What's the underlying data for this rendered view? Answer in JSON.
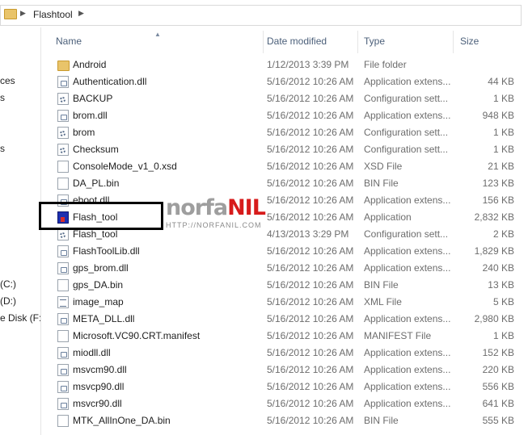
{
  "address": {
    "path": "Flashtool"
  },
  "nav": {
    "items": [
      "ces",
      "s",
      "s",
      "(C:)",
      "(D:)",
      "e Disk (F:)"
    ]
  },
  "columns": {
    "name": "Name",
    "date": "Date modified",
    "type": "Type",
    "size": "Size"
  },
  "files": [
    {
      "name": "Android",
      "date": "1/12/2013 3:39 PM",
      "type": "File folder",
      "size": "",
      "icon": "folder-icon"
    },
    {
      "name": "Authentication.dll",
      "date": "5/16/2012 10:26 AM",
      "type": "Application extens...",
      "size": "44 KB",
      "icon": "dll-icon"
    },
    {
      "name": "BACKUP",
      "date": "5/16/2012 10:26 AM",
      "type": "Configuration sett...",
      "size": "1 KB",
      "icon": "config-icon"
    },
    {
      "name": "brom.dll",
      "date": "5/16/2012 10:26 AM",
      "type": "Application extens...",
      "size": "948 KB",
      "icon": "dll-icon"
    },
    {
      "name": "brom",
      "date": "5/16/2012 10:26 AM",
      "type": "Configuration sett...",
      "size": "1 KB",
      "icon": "config-icon"
    },
    {
      "name": "Checksum",
      "date": "5/16/2012 10:26 AM",
      "type": "Configuration sett...",
      "size": "1 KB",
      "icon": "config-icon"
    },
    {
      "name": "ConsoleMode_v1_0.xsd",
      "date": "5/16/2012 10:26 AM",
      "type": "XSD File",
      "size": "21 KB",
      "icon": "document-icon"
    },
    {
      "name": "DA_PL.bin",
      "date": "5/16/2012 10:26 AM",
      "type": "BIN File",
      "size": "123 KB",
      "icon": "document-icon"
    },
    {
      "name": "eboot.dll",
      "date": "5/16/2012 10:26 AM",
      "type": "Application extens...",
      "size": "156 KB",
      "icon": "dll-icon"
    },
    {
      "name": "Flash_tool",
      "date": "5/16/2012 10:26 AM",
      "type": "Application",
      "size": "2,832 KB",
      "icon": "application-icon"
    },
    {
      "name": "Flash_tool",
      "date": "4/13/2013 3:29 PM",
      "type": "Configuration sett...",
      "size": "2 KB",
      "icon": "config-icon"
    },
    {
      "name": "FlashToolLib.dll",
      "date": "5/16/2012 10:26 AM",
      "type": "Application extens...",
      "size": "1,829 KB",
      "icon": "dll-icon"
    },
    {
      "name": "gps_brom.dll",
      "date": "5/16/2012 10:26 AM",
      "type": "Application extens...",
      "size": "240 KB",
      "icon": "dll-icon"
    },
    {
      "name": "gps_DA.bin",
      "date": "5/16/2012 10:26 AM",
      "type": "BIN File",
      "size": "13 KB",
      "icon": "document-icon"
    },
    {
      "name": "image_map",
      "date": "5/16/2012 10:26 AM",
      "type": "XML File",
      "size": "5 KB",
      "icon": "xml-icon"
    },
    {
      "name": "META_DLL.dll",
      "date": "5/16/2012 10:26 AM",
      "type": "Application extens...",
      "size": "2,980 KB",
      "icon": "dll-icon"
    },
    {
      "name": "Microsoft.VC90.CRT.manifest",
      "date": "5/16/2012 10:26 AM",
      "type": "MANIFEST File",
      "size": "1 KB",
      "icon": "document-icon"
    },
    {
      "name": "miodll.dll",
      "date": "5/16/2012 10:26 AM",
      "type": "Application extens...",
      "size": "152 KB",
      "icon": "dll-icon"
    },
    {
      "name": "msvcm90.dll",
      "date": "5/16/2012 10:26 AM",
      "type": "Application extens...",
      "size": "220 KB",
      "icon": "dll-icon"
    },
    {
      "name": "msvcp90.dll",
      "date": "5/16/2012 10:26 AM",
      "type": "Application extens...",
      "size": "556 KB",
      "icon": "dll-icon"
    },
    {
      "name": "msvcr90.dll",
      "date": "5/16/2012 10:26 AM",
      "type": "Application extens...",
      "size": "641 KB",
      "icon": "dll-icon"
    },
    {
      "name": "MTK_AllInOne_DA.bin",
      "date": "5/16/2012 10:26 AM",
      "type": "BIN File",
      "size": "555 KB",
      "icon": "document-icon"
    }
  ],
  "watermark": {
    "brand_part1": "norfa",
    "brand_part2": "NIL",
    "url": "HTTP://NORFANIL.COM"
  },
  "colors": {
    "highlight_border": "#000000",
    "brand_red": "#d71b1b",
    "brand_gray": "#9e9e9e"
  }
}
